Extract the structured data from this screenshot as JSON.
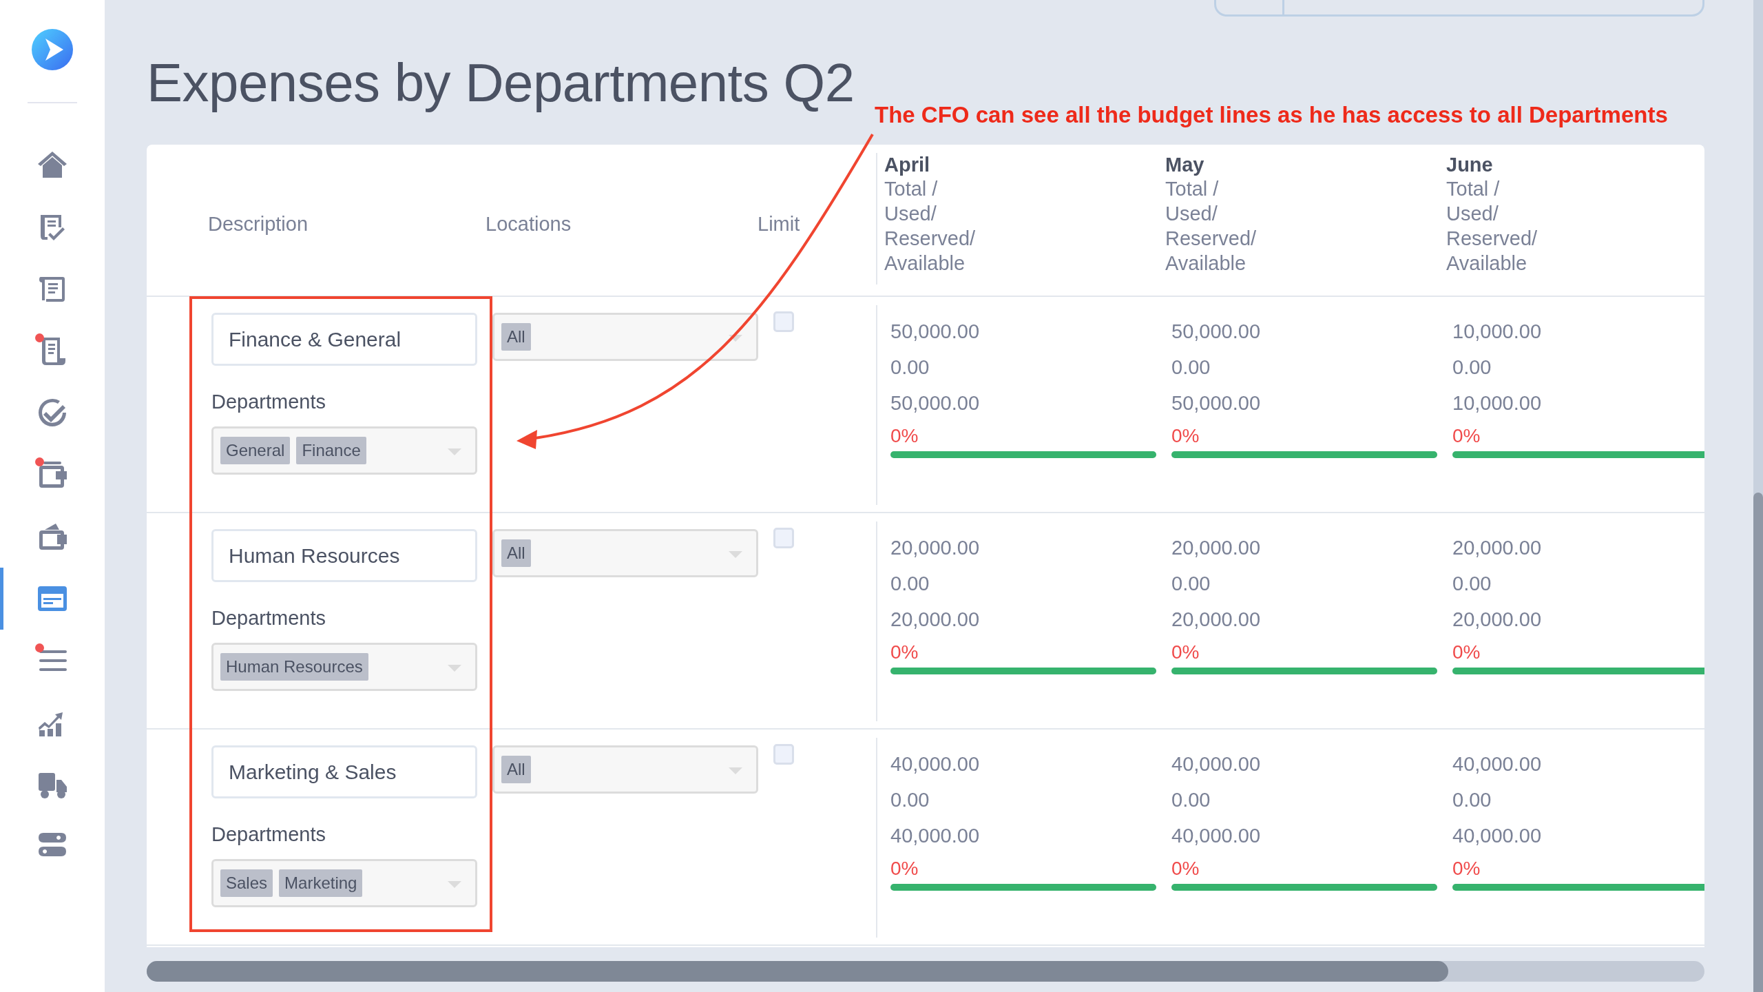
{
  "sidebar": {
    "items": [
      {
        "kind": "home",
        "selected": false,
        "notification": false
      },
      {
        "kind": "receipt-check",
        "selected": false,
        "notification": false
      },
      {
        "kind": "receipt",
        "selected": false,
        "notification": false
      },
      {
        "kind": "scroll",
        "selected": false,
        "notification": true
      },
      {
        "kind": "check-circle",
        "selected": false,
        "notification": false
      },
      {
        "kind": "wallet",
        "selected": false,
        "notification": true
      },
      {
        "kind": "wallet-open",
        "selected": false,
        "notification": false
      },
      {
        "kind": "card",
        "selected": true,
        "notification": false
      },
      {
        "kind": "list",
        "selected": false,
        "notification": true
      },
      {
        "kind": "chart",
        "selected": false,
        "notification": false
      },
      {
        "kind": "truck",
        "selected": false,
        "notification": false
      },
      {
        "kind": "toggle",
        "selected": false,
        "notification": false
      }
    ]
  },
  "page_title": "Expenses by Departments Q2",
  "annotation": {
    "text": "The CFO can see all the budget lines as he has access to all Departments"
  },
  "table": {
    "columns": [
      {
        "label": "Description"
      },
      {
        "label": "Locations"
      },
      {
        "label": "Limit"
      }
    ],
    "months": [
      {
        "name": "April",
        "lines": [
          "Total /",
          "Used/",
          "Reserved/",
          "Available"
        ]
      },
      {
        "name": "May",
        "lines": [
          "Total /",
          "Used/",
          "Reserved/",
          "Available"
        ]
      },
      {
        "name": "June",
        "lines": [
          "Total /",
          "Used/",
          "Reserved/",
          "Available"
        ]
      }
    ],
    "rows": [
      {
        "description": "Finance & General",
        "departments_label": "Departments",
        "departments": [
          "General",
          "Finance"
        ],
        "locations": [
          "All"
        ],
        "limit_checked": false,
        "months": [
          {
            "values": [
              "50,000.00",
              "0.00",
              "50,000.00"
            ],
            "percent": "0%",
            "level": 1
          },
          {
            "values": [
              "50,000.00",
              "0.00",
              "50,000.00"
            ],
            "percent": "0%",
            "level": 1
          },
          {
            "values": [
              "10,000.00",
              "0.00",
              "10,000.00"
            ],
            "percent": "0%",
            "level": 1
          }
        ]
      },
      {
        "description": "Human Resources",
        "departments_label": "Departments",
        "departments": [
          "Human Resources"
        ],
        "locations": [
          "All"
        ],
        "limit_checked": false,
        "months": [
          {
            "values": [
              "20,000.00",
              "0.00",
              "20,000.00"
            ],
            "percent": "0%",
            "level": 1
          },
          {
            "values": [
              "20,000.00",
              "0.00",
              "20,000.00"
            ],
            "percent": "0%",
            "level": 1
          },
          {
            "values": [
              "20,000.00",
              "0.00",
              "20,000.00"
            ],
            "percent": "0%",
            "level": 1
          }
        ]
      },
      {
        "description": "Marketing & Sales",
        "departments_label": "Departments",
        "departments": [
          "Sales",
          "Marketing"
        ],
        "locations": [
          "All"
        ],
        "limit_checked": false,
        "months": [
          {
            "values": [
              "40,000.00",
              "0.00",
              "40,000.00"
            ],
            "percent": "0%",
            "level": 1
          },
          {
            "values": [
              "40,000.00",
              "0.00",
              "40,000.00"
            ],
            "percent": "0%",
            "level": 1
          },
          {
            "values": [
              "40,000.00",
              "0.00",
              "40,000.00"
            ],
            "percent": "0%",
            "level": 1
          }
        ]
      }
    ]
  }
}
